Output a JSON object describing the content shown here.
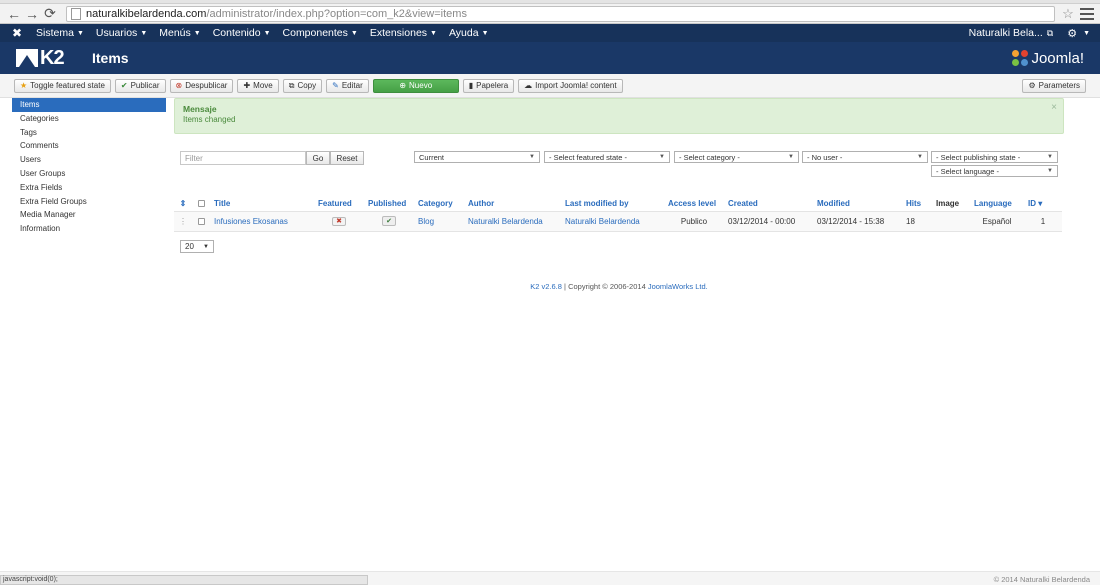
{
  "browser": {
    "url_host": "naturalkibelardenda.com",
    "url_path": "/administrator/index.php?option=com_k2&view=items",
    "status_text": "javascript:void(0);"
  },
  "adminbar": {
    "menus": [
      "Sistema",
      "Usuarios",
      "Menús",
      "Contenido",
      "Componentes",
      "Extensiones",
      "Ayuda"
    ],
    "user": "Naturalki Bela..."
  },
  "header": {
    "logo_text": "K2",
    "title": "Items",
    "brand": "Joomla!"
  },
  "toolbar": {
    "toggle_featured": "Toggle featured state",
    "publicar": "Publicar",
    "despublicar": "Despublicar",
    "move": "Move",
    "copy": "Copy",
    "editar": "Editar",
    "nuevo": "Nuevo",
    "papelera": "Papelera",
    "import": "Import Joomla! content",
    "parameters": "Parameters"
  },
  "sidebar": {
    "items": [
      {
        "label": "Items",
        "active": true
      },
      {
        "label": "Categories"
      },
      {
        "label": "Tags"
      },
      {
        "label": "Comments"
      },
      {
        "label": "Users"
      },
      {
        "label": "User Groups"
      },
      {
        "label": "Extra Fields"
      },
      {
        "label": "Extra Field Groups"
      },
      {
        "label": "Media Manager"
      },
      {
        "label": "Information"
      }
    ]
  },
  "alert": {
    "heading": "Mensaje",
    "message": "Items changed",
    "close": "×"
  },
  "filters": {
    "search_placeholder": "Filter",
    "go": "Go",
    "reset": "Reset",
    "trash": "Current",
    "featured": "- Select featured state -",
    "category": "- Select category -",
    "user": "- No user -",
    "publishing": "- Select publishing state -",
    "language": "- Select language -"
  },
  "table": {
    "headers": {
      "title": "Title",
      "featured": "Featured",
      "published": "Published",
      "category": "Category",
      "author": "Author",
      "last_modified_by": "Last modified by",
      "access_level": "Access level",
      "created": "Created",
      "modified": "Modified",
      "hits": "Hits",
      "image": "Image",
      "language": "Language",
      "id": "ID"
    },
    "rows": [
      {
        "title": "Infusiones Ekosanas",
        "featured": false,
        "published": true,
        "category": "Blog",
        "author": "Naturalki Belardenda",
        "last_modified_by": "Naturalki Belardenda",
        "access_level": "Publico",
        "created": "03/12/2014 - 00:00",
        "modified": "03/12/2014 - 15:38",
        "hits": "18",
        "language": "Español",
        "id": "1"
      }
    ],
    "limit": "20"
  },
  "footer": {
    "version_link": "K2 v2.6.8",
    "copyright": "| Copyright © 2006-2014",
    "company_link": "JoomlaWorks Ltd.",
    "site_copy": "© 2014 Naturalki Belardenda"
  },
  "colors": {
    "admin_nav": "#17325a",
    "k2_header": "#1a3867",
    "link": "#2a6cbd",
    "success_bg": "#dff0d8",
    "nuevo_green": "#5cb85c"
  }
}
